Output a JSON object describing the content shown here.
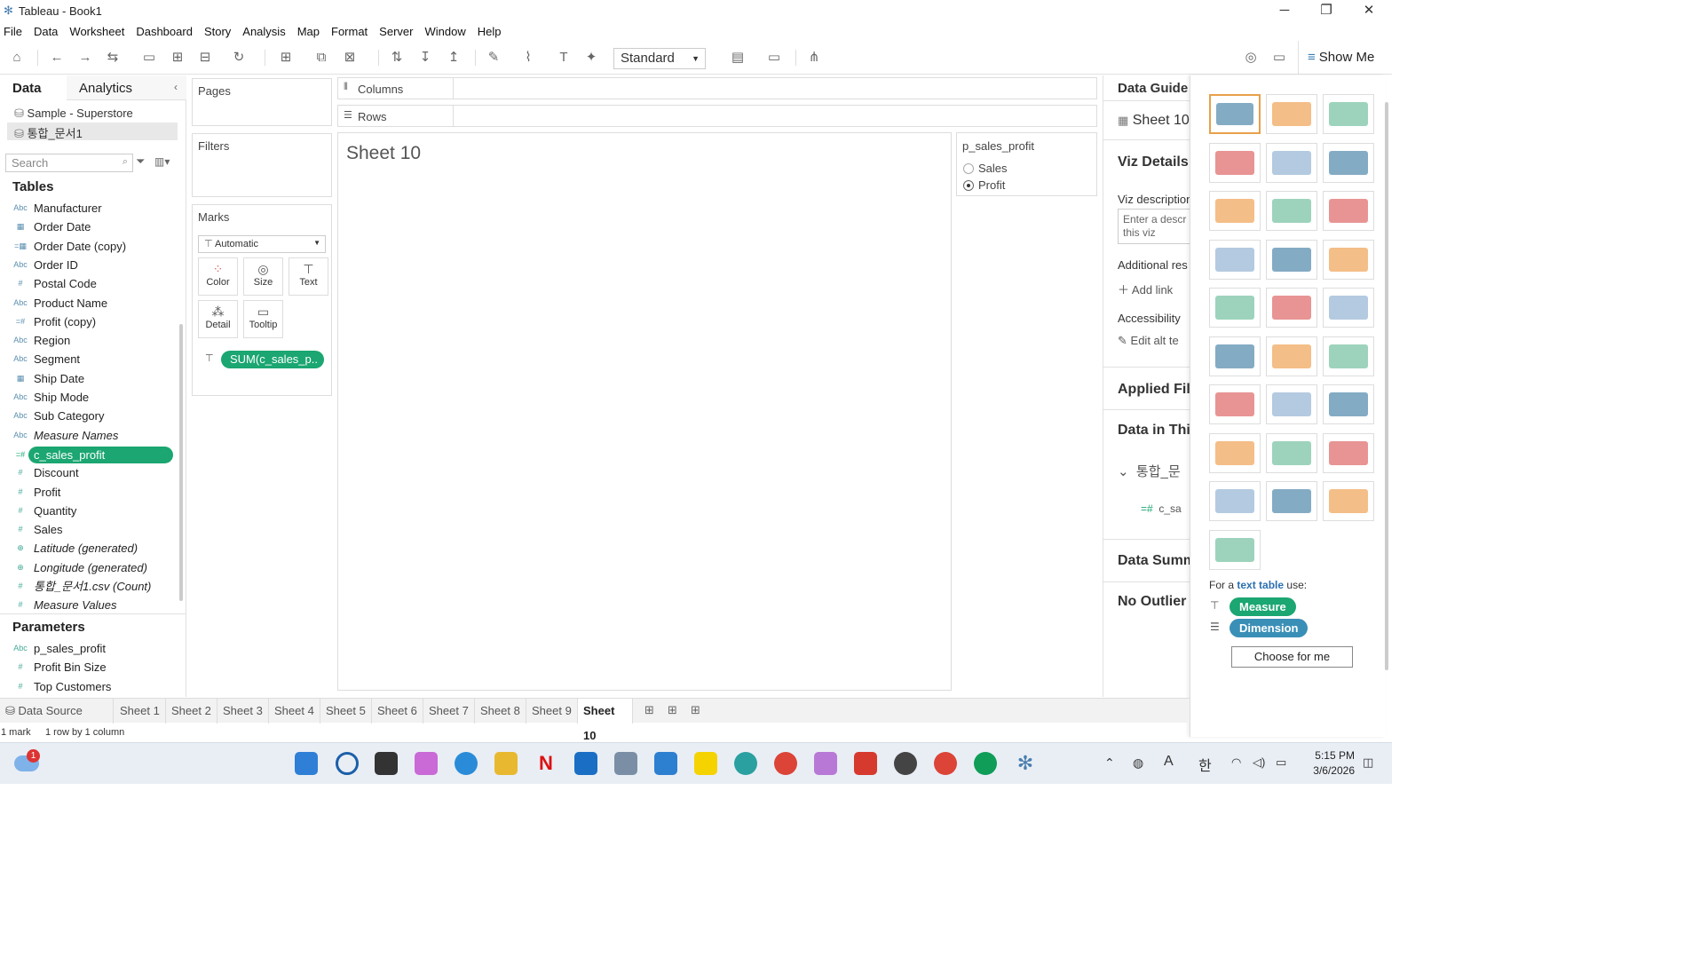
{
  "window": {
    "title": "Tableau - Book1"
  },
  "menu": [
    "File",
    "Data",
    "Worksheet",
    "Dashboard",
    "Story",
    "Analysis",
    "Map",
    "Format",
    "Server",
    "Window",
    "Help"
  ],
  "toolbar": {
    "fit_select": "Standard",
    "show_me": "Show Me"
  },
  "left": {
    "tab_data": "Data",
    "tab_analytics": "Analytics",
    "sources": [
      "Sample - Superstore",
      "통합_문서1"
    ],
    "search_placeholder": "Search",
    "tables_header": "Tables",
    "fields": [
      {
        "icon": "Abc",
        "label": "Manufacturer",
        "kind": "dim"
      },
      {
        "icon": "▦",
        "label": "Order Date",
        "kind": "dim"
      },
      {
        "icon": "=▦",
        "label": "Order Date (copy)",
        "kind": "dim"
      },
      {
        "icon": "Abc",
        "label": "Order ID",
        "kind": "dim"
      },
      {
        "icon": "#",
        "label": "Postal Code",
        "kind": "dim"
      },
      {
        "icon": "Abc",
        "label": "Product Name",
        "kind": "dim"
      },
      {
        "icon": "=#",
        "label": "Profit (copy)",
        "kind": "dim"
      },
      {
        "icon": "Abc",
        "label": "Region",
        "kind": "dim"
      },
      {
        "icon": "Abc",
        "label": "Segment",
        "kind": "dim"
      },
      {
        "icon": "▦",
        "label": "Ship Date",
        "kind": "dim"
      },
      {
        "icon": "Abc",
        "label": "Ship Mode",
        "kind": "dim"
      },
      {
        "icon": "Abc",
        "label": "Sub Category",
        "kind": "dim"
      },
      {
        "icon": "Abc",
        "label": "Measure Names",
        "kind": "dim",
        "italic": true
      },
      {
        "icon": "=#",
        "label": "c_sales_profit",
        "kind": "meas",
        "selected": true
      },
      {
        "icon": "#",
        "label": "Discount",
        "kind": "meas"
      },
      {
        "icon": "#",
        "label": "Profit",
        "kind": "meas"
      },
      {
        "icon": "#",
        "label": "Quantity",
        "kind": "meas"
      },
      {
        "icon": "#",
        "label": "Sales",
        "kind": "meas"
      },
      {
        "icon": "⊕",
        "label": "Latitude (generated)",
        "kind": "meas",
        "italic": true
      },
      {
        "icon": "⊕",
        "label": "Longitude (generated)",
        "kind": "meas",
        "italic": true
      },
      {
        "icon": "#",
        "label": "통합_문서1.csv (Count)",
        "kind": "meas",
        "italic": true
      },
      {
        "icon": "#",
        "label": "Measure Values",
        "kind": "meas",
        "italic": true
      }
    ],
    "parameters_header": "Parameters",
    "parameters": [
      {
        "icon": "Abc",
        "label": "p_sales_profit"
      },
      {
        "icon": "#",
        "label": "Profit Bin Size"
      },
      {
        "icon": "#",
        "label": "Top Customers"
      }
    ]
  },
  "cards": {
    "pages": "Pages",
    "filters": "Filters",
    "marks": "Marks",
    "mark_type": "Automatic",
    "mark_buttons": [
      "Color",
      "Size",
      "Text",
      "Detail",
      "Tooltip"
    ],
    "mark_pill": "SUM(c_sales_p.."
  },
  "shelves": {
    "columns": "Columns",
    "rows": "Rows"
  },
  "view": {
    "sheet_title": "Sheet 10"
  },
  "parameter_card": {
    "title": "p_sales_profit",
    "options": [
      "Sales",
      "Profit"
    ],
    "selected": "Profit"
  },
  "guide": {
    "title": "Data Guide",
    "sheet": "Sheet 10",
    "viz_details": "Viz Details",
    "viz_description": "Viz description",
    "desc_placeholder": "Enter a descr this viz",
    "additional": "Additional res",
    "add_link": "Add link",
    "accessibility": "Accessibility",
    "edit_alt": "Edit alt te",
    "applied_filters": "Applied Filte",
    "data_in_this": "Data in This",
    "source_short": "통합_문",
    "field_short": "c_sa",
    "data_summary": "Data Summ",
    "no_outlier": "No Outlier M"
  },
  "showme": {
    "for_text": "For a",
    "for_link": "text table",
    "for_use": "use:",
    "measure": "Measure",
    "dimension": "Dimension",
    "choose": "Choose for me"
  },
  "tabs": [
    "Sheet 1",
    "Sheet 2",
    "Sheet 3",
    "Sheet 4",
    "Sheet 5",
    "Sheet 6",
    "Sheet 7",
    "Sheet 8",
    "Sheet 9",
    "Sheet 10"
  ],
  "datasource_tab": "Data Source",
  "active_tab": "Sheet 10",
  "status": {
    "marks": "1 mark",
    "dims": "1 row by 1 column"
  },
  "taskbar": {
    "time": "5:15 PM",
    "date": "3/6/2026",
    "badge": "1",
    "ime": "한",
    "lang": "A"
  },
  "colors": {
    "measure_green": "#1ba672",
    "dimension_blue": "#3a8fb7",
    "accent_orange": "#e8a04a"
  }
}
